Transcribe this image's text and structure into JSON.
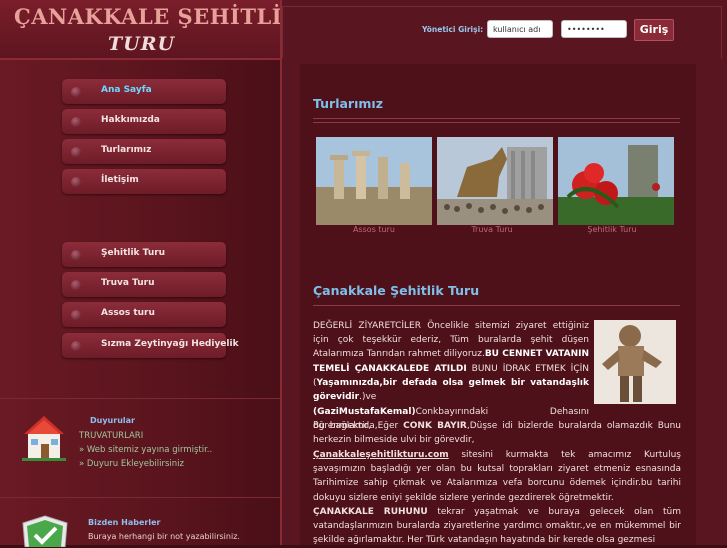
{
  "logo": {
    "line1": "ÇANAKKALE ŞEHİTLİK",
    "line2": "TURU"
  },
  "login": {
    "label": "Yönetici Girişi:",
    "username_value": "kullanıcı adı",
    "password_value": "••••••••",
    "button": "Giriş"
  },
  "menu": {
    "group1": [
      "Ana Sayfa",
      "Hakkımızda",
      "Turlarımız",
      "İletişim"
    ],
    "group2": [
      "Şehitlik Turu",
      "Truva Turu",
      "Assos turu",
      "Sızma Zeytinyağı Hediyelik"
    ]
  },
  "announcements": {
    "title": "Duyurular",
    "subtitle": "TRUVATURLARI",
    "items": [
      "» Web sitemiz yayına girmiştir..",
      "» Duyuru Ekleyebilirsiniz"
    ]
  },
  "news": {
    "title": "Bizden Haberler",
    "text": "Buraya herhangi bir not yazabilirsiniz."
  },
  "tours": {
    "title": "Turlarımız",
    "captions": [
      "Assos turu",
      "Truva Turu",
      "Şehitlik Turu"
    ]
  },
  "article": {
    "title": "Çanakkale Şehitlik Turu",
    "p1_a": "DEĞERLİ ZİYARETCİLER Öncelikle sitemizi ziyaret ettiğiniz için çok teşekkür ederiz, Tüm buralarda şehit düşen Atalarımıza Tanrıdan rahmet diliyoruz.",
    "p1_b": "BU CENNET VATANIN TEMELİ ÇANAKKALEDE ATILDI",
    "p1_c": " BUNU İDRAK ETMEK İÇİN (",
    "p1_d": "Yaşamınızda,bir defada olsa gelmek bir vatandaşlık görevidir",
    "p1_e": ".)ve",
    "p2_a": "(GaziMustafaKemal)",
    "p2_b": "Conkbayırındaki Dehasını öğrenmektir,",
    "p3_a": "Bu bağlamda,Eğer ",
    "p3_b": "CONK BAYIR",
    "p3_c": ",Düşse idi bizlerde buralarda olamazdık Bunu herkezin bilmeside ulvi bir görevdir,",
    "p4_a": "Çanakkaleşehitlikturu.com",
    "p4_b": " sitesini kurmakta tek amacımız Kurtuluş şavaşımızın başladığı yer olan bu kutsal toprakları ziyaret etmeniz esnasında Tarihimize sahip çıkmak ve Atalarımıza vefa borcunu ödemek içindir.bu tarihi dokuyu sizlere eniyi şekilde sizlere yerinde gezdirerek öğretmektir.",
    "p5_a": "ÇANAKKALE RUHUNU",
    "p5_b": " tekrar yaşatmak ve buraya gelecek olan tüm vatandaşlarımızın buralarda ziyaretlerine yardımcı omaktır.,ve en mükemmel bir şekilde ağırlamaktır. Her Türk vatandaşın hayatında bir kerede olsa gezmesi"
  },
  "colors": {
    "accent_blue": "#7ec0ea",
    "menu_active": "#6fd8ff",
    "bg_dark": "#4e1019"
  }
}
